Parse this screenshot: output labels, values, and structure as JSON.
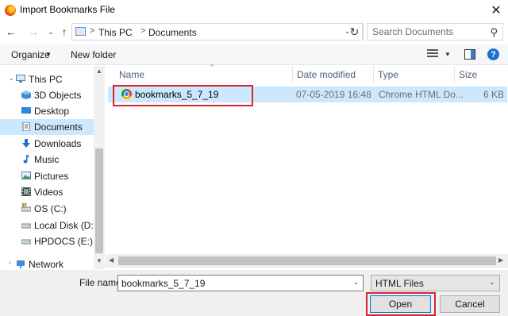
{
  "window": {
    "title": "Import Bookmarks File",
    "close_glyph": "✕"
  },
  "address": {
    "path": [
      "This PC",
      "Documents"
    ],
    "separator": ">",
    "back_glyph": "←",
    "forward_glyph": "→",
    "recent_glyph": "⌄",
    "up_glyph": "↑",
    "dropdown_glyph": "⌄",
    "refresh_glyph": "↻"
  },
  "search": {
    "placeholder": "Search Documents",
    "icon": "⚲"
  },
  "toolbar": {
    "organize": "Organize",
    "organize_caret": "▼",
    "new_folder": "New folder",
    "view_caret": "▼",
    "help": "?"
  },
  "nav": {
    "items": [
      {
        "label": "This PC",
        "icon": "pc-icon",
        "expander": "⌄"
      },
      {
        "label": "3D Objects",
        "icon": "3d-objects-icon"
      },
      {
        "label": "Desktop",
        "icon": "desktop-icon"
      },
      {
        "label": "Documents",
        "icon": "documents-icon",
        "selected": true
      },
      {
        "label": "Downloads",
        "icon": "download-arrow-icon"
      },
      {
        "label": "Music",
        "icon": "music-note-icon"
      },
      {
        "label": "Pictures",
        "icon": "pictures-icon"
      },
      {
        "label": "Videos",
        "icon": "videos-icon"
      },
      {
        "label": "OS (C:)",
        "icon": "drive-c-icon"
      },
      {
        "label": "Local Disk (D:)",
        "icon": "drive-d-icon"
      },
      {
        "label": "HPDOCS (E:)",
        "icon": "drive-e-icon"
      },
      {
        "label": "Network",
        "icon": "network-icon",
        "expander": "›"
      }
    ],
    "scroll_up_glyph": "▲",
    "scroll_down_glyph": "▼"
  },
  "columns": {
    "name": "Name",
    "date": "Date modified",
    "type": "Type",
    "size": "Size",
    "sort_caret": "^"
  },
  "files": [
    {
      "name": "bookmarks_5_7_19",
      "date": "07-05-2019 16:48",
      "type": "Chrome HTML Do...",
      "size": "6 KB",
      "icon": "chrome-icon",
      "selected": true
    }
  ],
  "hscroll": {
    "left_glyph": "◀",
    "right_glyph": "▶"
  },
  "footer": {
    "filename_label": "File name:",
    "filename_value": "bookmarks_5_7_19",
    "filetype_value": "HTML Files",
    "dropdown_glyph": "⌄",
    "open": "Open",
    "cancel": "Cancel"
  },
  "colors": {
    "selection": "#cce8ff",
    "highlight_box": "#d9232d",
    "accent": "#0078d7"
  }
}
